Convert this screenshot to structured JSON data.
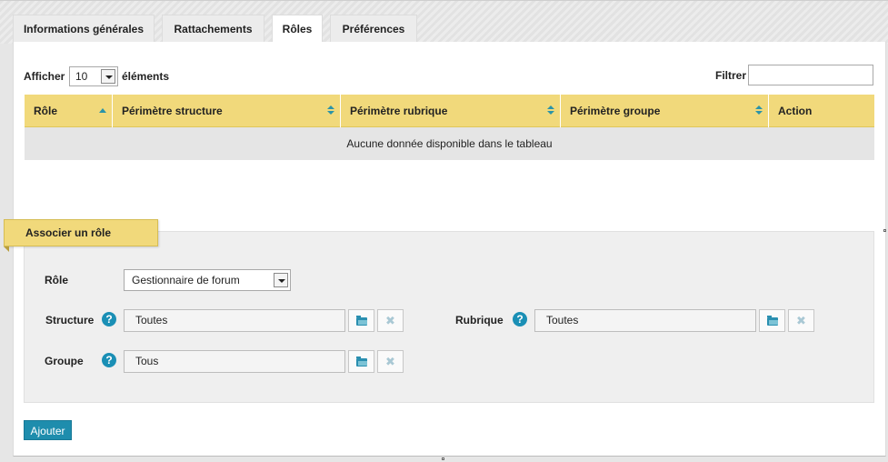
{
  "tabs": [
    {
      "label": "Informations générales",
      "active": false
    },
    {
      "label": "Rattachements",
      "active": false
    },
    {
      "label": "Rôles",
      "active": true
    },
    {
      "label": "Préférences",
      "active": false
    }
  ],
  "table_controls": {
    "show_label": "Afficher",
    "page_size": "10",
    "elements_label": "éléments",
    "filter_label": "Filtrer",
    "filter_value": ""
  },
  "table": {
    "columns": [
      "Rôle",
      "Périmètre structure",
      "Périmètre rubrique",
      "Périmètre groupe",
      "Action"
    ],
    "empty_message": "Aucune donnée disponible dans le tableau"
  },
  "associate": {
    "title": "Associer un rôle",
    "role_label": "Rôle",
    "role_value": "Gestionnaire de forum",
    "structure_label": "Structure",
    "structure_value": "Toutes",
    "rubrique_label": "Rubrique",
    "rubrique_value": "Toutes",
    "groupe_label": "Groupe",
    "groupe_value": "Tous",
    "help_glyph": "?",
    "clear_glyph": "✖"
  },
  "actions": {
    "add_label": "Ajouter"
  },
  "colors": {
    "header_yellow": "#f1d97b",
    "accent_blue": "#1e8dad"
  }
}
